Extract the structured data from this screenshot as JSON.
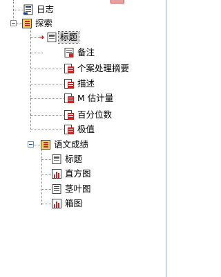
{
  "tree": {
    "log": {
      "label": "日志",
      "icon": "log-icon"
    },
    "explore": {
      "label": "探索",
      "icon": "section-icon",
      "expanded": true
    },
    "explore_items": [
      {
        "label": "标题",
        "icon": "title-icon",
        "selected": true
      },
      {
        "label": "备注",
        "icon": "note-icon"
      },
      {
        "label": "个案处理摘要",
        "icon": "table-icon"
      },
      {
        "label": "描述",
        "icon": "table-icon"
      },
      {
        "label": "M 估计量",
        "icon": "table-icon"
      },
      {
        "label": "百分位数",
        "icon": "table-icon"
      },
      {
        "label": "极值",
        "icon": "table-icon"
      }
    ],
    "group": {
      "label": "语文成绩",
      "icon": "section-icon",
      "expanded": true
    },
    "group_items": [
      {
        "label": "标题",
        "icon": "title-icon"
      },
      {
        "label": "直方图",
        "icon": "chart-icon"
      },
      {
        "label": "茎叶图",
        "icon": "text-icon"
      },
      {
        "label": "箱图",
        "icon": "chart-icon"
      }
    ]
  },
  "colors": {
    "selection": "#d8d8d8",
    "accent_red": "#d62020",
    "tree_lines": "#8a8a8a"
  }
}
